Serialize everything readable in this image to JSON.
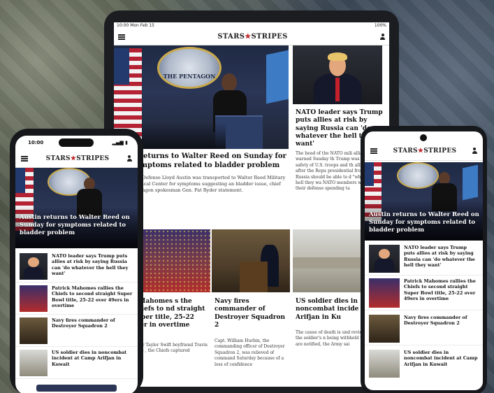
{
  "brand": {
    "name_left": "STARS",
    "name_right": "STRIPES"
  },
  "tablet": {
    "status_time": "10:00 Mon Feb 15",
    "status_right": "100%",
    "hero_title": "n returns to Walter Reed on Sunday for symptoms related to bladder problem",
    "hero_body": "y of Defense Lloyd Austin was transported to Walter Reed Military Medical Center for symptoms suggesting an bladder issue, chief Pentagon spokesman Gen. Pat Ryder statement.",
    "seal_text": "THE PENTAGON",
    "side_title": "NATO leader says Trump puts allies at risk by saying Russia can 'do whatever the hell they want'",
    "side_body": "The head of the NATO mili alliance warned Sunday th Trump was putting safety of U.S. troops and th allies at risk after the Repu presidential front-runner Russia should be able to d \"whatever the hell they wa NATO members who don't their defense spending ta",
    "cards": [
      {
        "title": "k Mahomes s the Chiefs to nd straight Super title, 25-22 over in overtime",
        "body": "p star Taylor Swift boyfriend Travis Kelce , the Chiefs captured"
      },
      {
        "title": "Navy fires commander of Destroyer Squadron 2",
        "body": "Capt. William Hurbin, the commanding officer of Destroyer Squadron 2, was relieved of command Saturday because of a loss of confidence"
      },
      {
        "title": "US soldier dies in noncombat incide Camp Arifjan in Ku",
        "body": "The cause of death is und review and the soldier's n being withheld until next are notified, the Army sai"
      }
    ]
  },
  "phone_left": {
    "time": "10:00",
    "hero_title": "Austin returns to Walter Reed on Sunday for symptoms related to bladder problem",
    "items": [
      "NATO leader says Trump puts allies at risk by saying Russia can 'do whatever the hell they want'",
      "Patrick Mahomes rallies the Chiefs to second straight Super Bowl title, 25-22 over 49ers in overtime",
      "Navy fires commander of Destroyer Squadron 2",
      "US soldier dies in noncombat incident at Camp Arifjan in Kuwait"
    ]
  },
  "phone_right": {
    "hero_title": "Austin returns to Walter Reed on Sunday for symptoms related to bladder problem",
    "items": [
      "NATO leader says Trump puts allies at risk by saying Russia can 'do whatever the hell they want'",
      "Patrick Mahomes rallies the Chiefs to second straight Super Bowl title, 25-22 over 49ers in overtime",
      "Navy fires commander of Destroyer Squadron 2",
      "US soldier dies in noncombat incident at Camp Arifjan in Kuwait"
    ]
  }
}
